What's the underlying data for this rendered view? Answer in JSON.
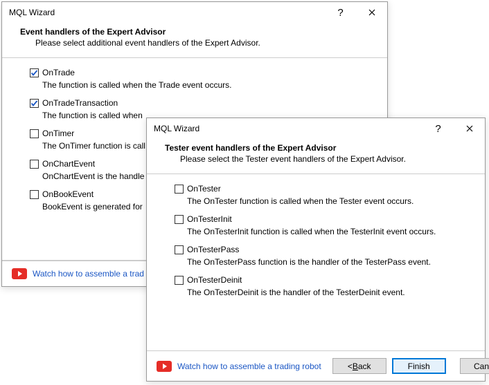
{
  "back": {
    "title": "MQL Wizard",
    "heading": "Event handlers of the Expert Advisor",
    "subheading": "Please select additional event handlers of the Expert Advisor.",
    "options": [
      {
        "label": "OnTrade",
        "desc": "The function is called when the Trade event occurs.",
        "checked": true
      },
      {
        "label": "OnTradeTransaction",
        "desc": "The function is called when",
        "checked": true
      },
      {
        "label": "OnTimer",
        "desc": "The OnTimer function is call",
        "checked": false
      },
      {
        "label": "OnChartEvent",
        "desc": "OnChartEvent is the handle",
        "checked": false
      },
      {
        "label": "OnBookEvent",
        "desc": "BookEvent is generated for",
        "checked": false
      }
    ],
    "link": "Watch how to assemble a trad"
  },
  "front": {
    "title": "MQL Wizard",
    "heading": "Tester event handlers of the Expert Advisor",
    "subheading": "Please select the Tester event handlers of the Expert Advisor.",
    "options": [
      {
        "label": "OnTester",
        "desc": "The OnTester function is called when the Tester event occurs.",
        "checked": false
      },
      {
        "label": "OnTesterInit",
        "desc": "The OnTesterInit function is called when the TesterInit event occurs.",
        "checked": false
      },
      {
        "label": "OnTesterPass",
        "desc": "The OnTesterPass function is the handler of the TesterPass event.",
        "checked": false
      },
      {
        "label": "OnTesterDeinit",
        "desc": "The OnTesterDeinit is the handler of the TesterDeinit event.",
        "checked": false
      }
    ],
    "link": "Watch how to assemble a trading robot",
    "buttons": {
      "back_pre": "< ",
      "back_u": "B",
      "back_post": "ack",
      "finish": "Finish",
      "cancel": "Cancel"
    }
  }
}
